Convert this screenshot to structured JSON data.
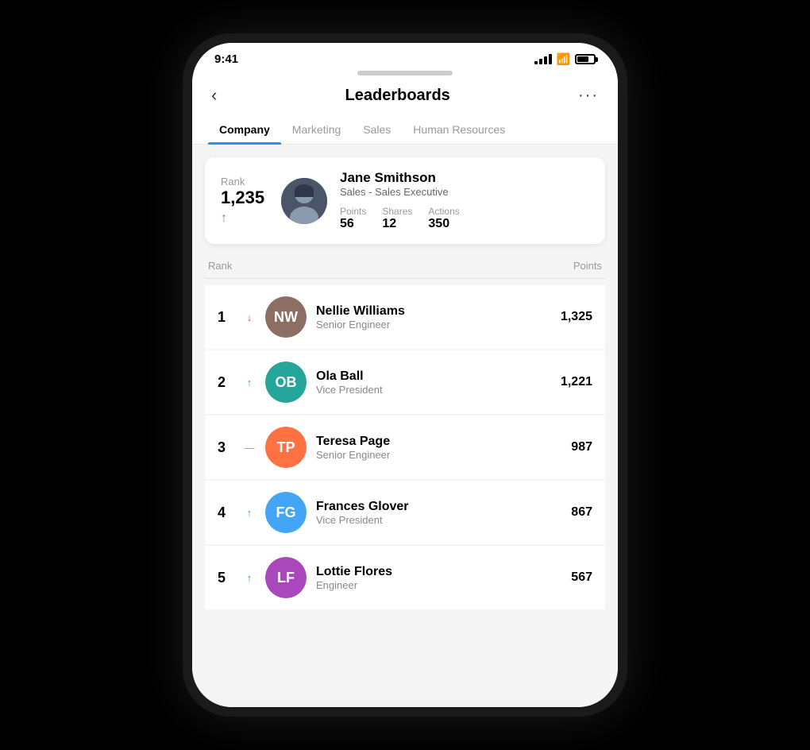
{
  "status": {
    "time": "9:41"
  },
  "header": {
    "title": "Leaderboards",
    "back_label": "‹",
    "more_label": "···"
  },
  "tabs": [
    {
      "id": "company",
      "label": "Company",
      "active": true
    },
    {
      "id": "marketing",
      "label": "Marketing",
      "active": false
    },
    {
      "id": "sales",
      "label": "Sales",
      "active": false
    },
    {
      "id": "hr",
      "label": "Human Resources",
      "active": false
    }
  ],
  "my_rank": {
    "rank_label": "Rank",
    "rank_number": "1,235",
    "trend": "↑",
    "name": "Jane Smithson",
    "title": "Sales - Sales Executive",
    "points_label": "Points",
    "points_value": "56",
    "shares_label": "Shares",
    "shares_value": "12",
    "actions_label": "Actions",
    "actions_value": "350"
  },
  "list_header": {
    "rank_col": "Rank",
    "points_col": "Points"
  },
  "leaderboard": [
    {
      "rank": "1",
      "trend": "↓",
      "trend_type": "down",
      "name": "Nellie Williams",
      "title": "Senior Engineer",
      "points": "1,325",
      "avatar_initials": "NW",
      "avatar_color": "avatar-brown"
    },
    {
      "rank": "2",
      "trend": "↑",
      "trend_type": "up",
      "name": "Ola Ball",
      "title": "Vice President",
      "points": "1,221",
      "avatar_initials": "OB",
      "avatar_color": "avatar-teal"
    },
    {
      "rank": "3",
      "trend": "—",
      "trend_type": "neutral",
      "name": "Teresa Page",
      "title": "Senior Engineer",
      "points": "987",
      "avatar_initials": "TP",
      "avatar_color": "avatar-orange"
    },
    {
      "rank": "4",
      "trend": "↑",
      "trend_type": "up",
      "name": "Frances Glover",
      "title": "Vice President",
      "points": "867",
      "avatar_initials": "FG",
      "avatar_color": "avatar-blue"
    },
    {
      "rank": "5",
      "trend": "↑",
      "trend_type": "up",
      "name": "Lottie Flores",
      "title": "Engineer",
      "points": "567",
      "avatar_initials": "LF",
      "avatar_color": "avatar-purple"
    }
  ]
}
